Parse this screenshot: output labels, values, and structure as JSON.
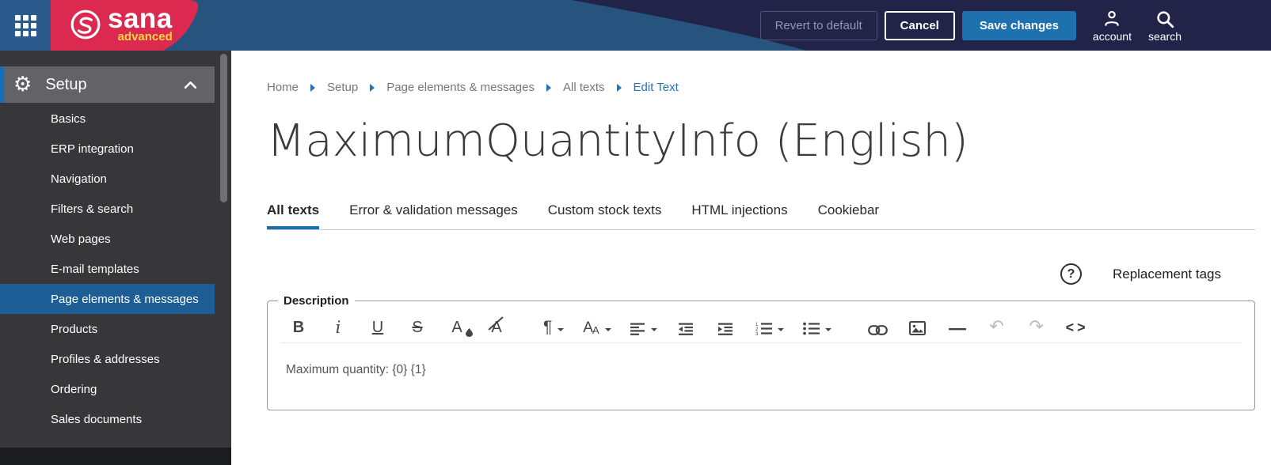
{
  "header": {
    "brand": {
      "name": "sana",
      "tagline": "advanced"
    },
    "actions": {
      "revert": "Revert to default",
      "cancel": "Cancel",
      "save": "Save changes"
    },
    "account": {
      "label": "account"
    },
    "search": {
      "label": "search"
    }
  },
  "sidebar": {
    "section": {
      "label": "Setup"
    },
    "items": [
      {
        "label": "Basics"
      },
      {
        "label": "ERP integration"
      },
      {
        "label": "Navigation"
      },
      {
        "label": "Filters & search"
      },
      {
        "label": "Web pages"
      },
      {
        "label": "E-mail templates"
      },
      {
        "label": "Page elements & messages",
        "active": true
      },
      {
        "label": "Products"
      },
      {
        "label": "Profiles & addresses"
      },
      {
        "label": "Ordering"
      },
      {
        "label": "Sales documents"
      }
    ]
  },
  "breadcrumb": {
    "items": [
      "Home",
      "Setup",
      "Page elements & messages",
      "All texts"
    ],
    "current": "Edit Text"
  },
  "page": {
    "title": "MaximumQuantityInfo (English)"
  },
  "tabs": [
    {
      "label": "All texts",
      "active": true
    },
    {
      "label": "Error & validation messages"
    },
    {
      "label": "Custom stock texts"
    },
    {
      "label": "HTML injections"
    },
    {
      "label": "Cookiebar"
    }
  ],
  "help": {
    "icon": "?",
    "label": "Replacement tags"
  },
  "editor": {
    "legend": "Description",
    "content": "Maximum quantity: {0} {1}",
    "toolbar": {
      "bold": "B",
      "italic": "i",
      "underline": "U",
      "strikethrough": "S",
      "text_color": "A",
      "clear_format": "A",
      "paragraph": "¶",
      "font_size_big": "A",
      "font_size_small": "A",
      "undo": "↶",
      "redo": "↷",
      "code": "<>",
      "icon_names": "bold, italic, underline, strikethrough, text-color, clear-format, paragraph-style, font-size, align, outdent, indent, ordered-list, unordered-list, link, image, horizontal-line, undo, redo, code-view"
    }
  },
  "colors": {
    "header_navy": "#212348",
    "header_blue": "#27547F",
    "tile_blue": "#2B5B8C",
    "brand_red": "#DC2950",
    "tagline_yellow": "#FFD83D",
    "save_button_blue": "#1E70AE",
    "sidebar_dark": "#37373A",
    "active_item_blue": "#1D5E96",
    "link_blue": "#2273B8",
    "tab_underline": "#1B6FAD"
  }
}
